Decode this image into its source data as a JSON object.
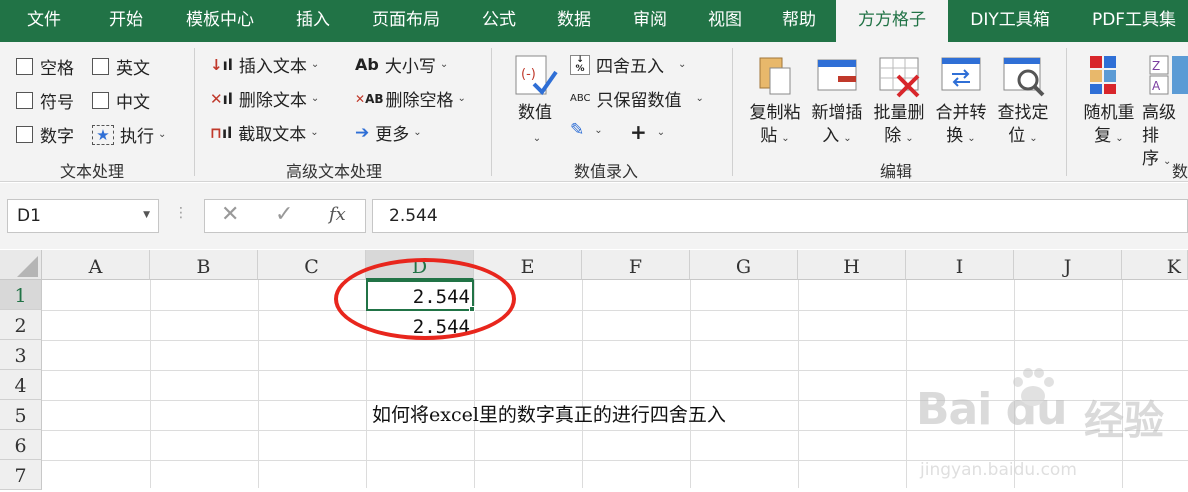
{
  "tabs": [
    "文件",
    "开始",
    "模板中心",
    "插入",
    "页面布局",
    "公式",
    "数据",
    "审阅",
    "视图",
    "帮助",
    "方方格子",
    "DIY工具箱",
    "PDF工具集"
  ],
  "active_tab": "方方格子",
  "ribbon": {
    "text_group": {
      "label": "文本处理",
      "checks": [
        "空格",
        "英文",
        "符号",
        "中文",
        "数字"
      ],
      "exec": "执行"
    },
    "adv_group": {
      "label": "高级文本处理",
      "insert_text": "插入文本",
      "delete_text": "删除文本",
      "extract_text": "截取文本",
      "case": "大小写",
      "delete_space": "删除空格",
      "more": "更多",
      "case_icon": "Ab",
      "del_space_icon": "AB"
    },
    "num_group": {
      "label": "数值录入",
      "value": "数值",
      "round": "四舍五入",
      "keep_value": "只保留数值",
      "abc_icon": "ABC"
    },
    "edit_group": {
      "label": "编辑",
      "copy_paste": [
        "复制粘",
        "贴"
      ],
      "add_insert": [
        "新增插",
        "入"
      ],
      "batch_delete": [
        "批量删",
        "除"
      ],
      "merge_convert": [
        "合并转",
        "换"
      ],
      "find_locate": [
        "查找定",
        "位"
      ]
    },
    "last_group": {
      "label": "数",
      "random_repeat": [
        "随机重",
        "复"
      ],
      "advanced_sort": [
        "高级排",
        "序"
      ]
    }
  },
  "formula_bar": {
    "name_box": "D1",
    "value": "2.544",
    "fx": "fx"
  },
  "grid": {
    "columns": [
      "A",
      "B",
      "C",
      "D",
      "E",
      "F",
      "G",
      "H",
      "I",
      "J",
      "K"
    ],
    "rows": [
      "1",
      "2",
      "3",
      "4",
      "5",
      "6",
      "7"
    ],
    "selected_column": "D",
    "selected_row": "1",
    "cells": {
      "D1": "2.544",
      "D2": "2.544",
      "D5": "如何将excel里的数字真正的进行四舍五入"
    }
  },
  "watermark": {
    "logo": "Bai du",
    "product": "经验",
    "url": "jingyan.baidu.com"
  },
  "colors": {
    "accent": "#217346",
    "highlight": "#e8261d"
  }
}
